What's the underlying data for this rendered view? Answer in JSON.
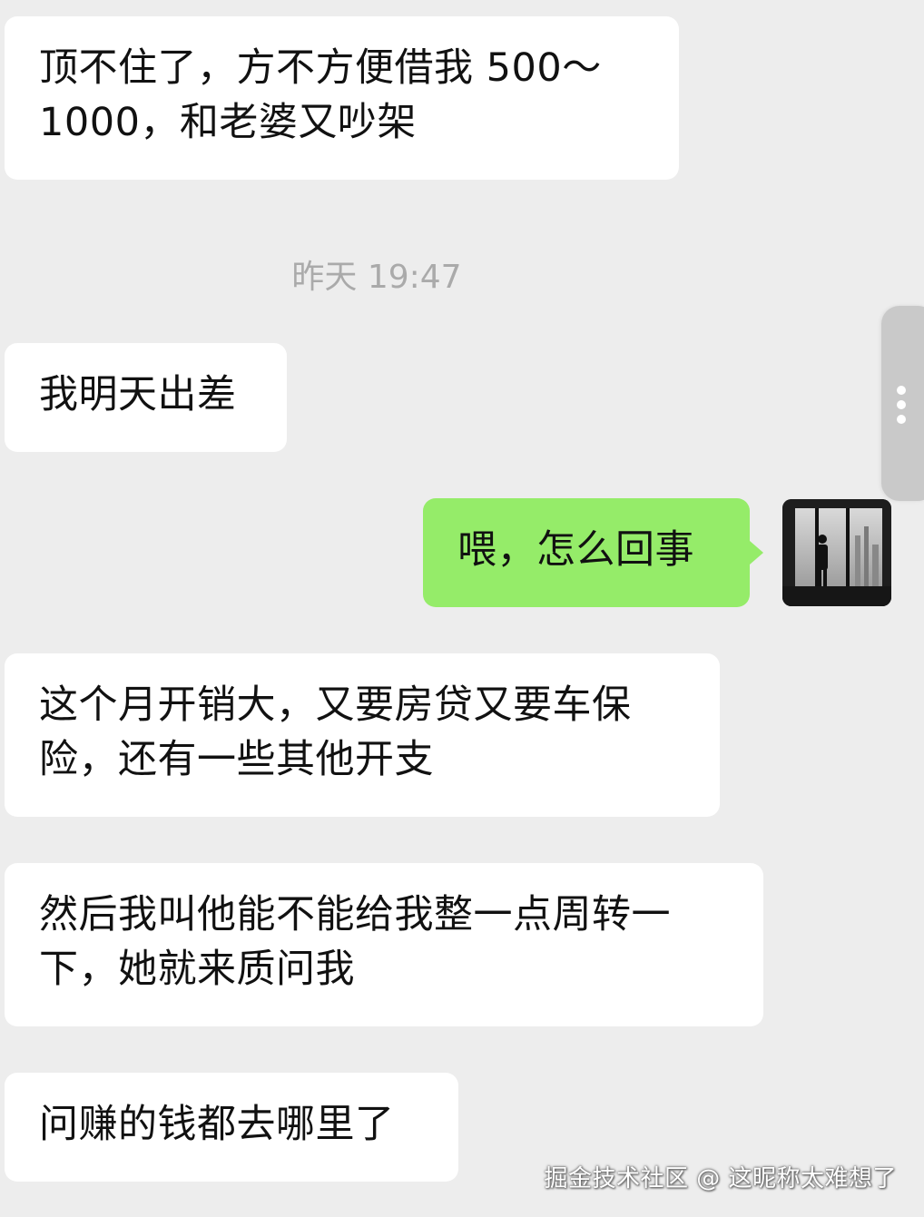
{
  "timestamp": "昨天 19:47",
  "messages": [
    {
      "side": "left",
      "text": "顶不住了，方不方便借我 500～1000，和老婆又吵架"
    },
    {
      "side": "left",
      "text": "我明天出差"
    },
    {
      "side": "right",
      "text": "喂，怎么回事"
    },
    {
      "side": "left",
      "text": "这个月开销大，又要房贷又要车保险，还有一些其他开支"
    },
    {
      "side": "left",
      "text": "然后我叫他能不能给我整一点周转一下，她就来质问我"
    },
    {
      "side": "left",
      "text": "问赚的钱都去哪里了"
    }
  ],
  "watermark": "掘金技术社区 @ 这昵称太难想了",
  "colors": {
    "background": "#ededed",
    "incoming_bubble": "#ffffff",
    "outgoing_bubble": "#95ec69"
  },
  "icons": {
    "side_handle": "more-vertical-icon",
    "avatar": "person-by-window-photo"
  }
}
